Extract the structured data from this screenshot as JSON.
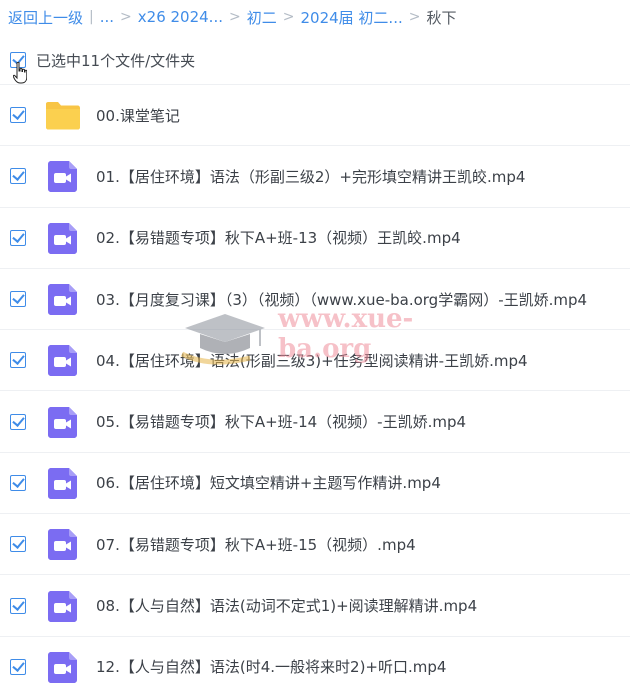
{
  "breadcrumb": {
    "back_label": "返回上一级",
    "first_sep": "|",
    "ellipsis": "...",
    "items": [
      "x26 2024...",
      "初二",
      "2024届 初二..."
    ],
    "current": "秋下",
    "sep": ">"
  },
  "selection": {
    "label": "已选中11个文件/文件夹",
    "checked": true
  },
  "watermark": {
    "text": "www.xue-ba.org"
  },
  "files": [
    {
      "name": "00.课堂笔记",
      "type": "folder-icon",
      "checked": true
    },
    {
      "name": "01.【居住环境】语法（形副三级2）+完形填空精讲王凯皎.mp4",
      "type": "video-file-icon",
      "checked": true
    },
    {
      "name": "02.【易错题专项】秋下A+班-13（视频）王凯皎.mp4",
      "type": "video-file-icon",
      "checked": true
    },
    {
      "name": "03.【月度复习课】（3）（视频）（www.xue-ba.org学霸网）-王凯娇.mp4",
      "type": "video-file-icon",
      "checked": true
    },
    {
      "name": "04.【居住环境】语法(形副三级3)+任务型阅读精讲-王凯娇.mp4",
      "type": "video-file-icon",
      "checked": true
    },
    {
      "name": "05.【易错题专项】秋下A+班-14（视频）-王凯娇.mp4",
      "type": "video-file-icon",
      "checked": true
    },
    {
      "name": "06.【居住环境】短文填空精讲+主题写作精讲.mp4",
      "type": "video-file-icon",
      "checked": true
    },
    {
      "name": "07.【易错题专项】秋下A+班-15（视频）.mp4",
      "type": "video-file-icon",
      "checked": true
    },
    {
      "name": "08.【人与自然】语法(动词不定式1)+阅读理解精讲.mp4",
      "type": "video-file-icon",
      "checked": true
    },
    {
      "name": "12.【人与自然】语法(时4.一般将来时2)+听口.mp4",
      "type": "video-file-icon",
      "checked": true
    }
  ],
  "colors": {
    "accent": "#3f8ce8",
    "folder": "#f8c545",
    "video": "#7b6cf2"
  }
}
